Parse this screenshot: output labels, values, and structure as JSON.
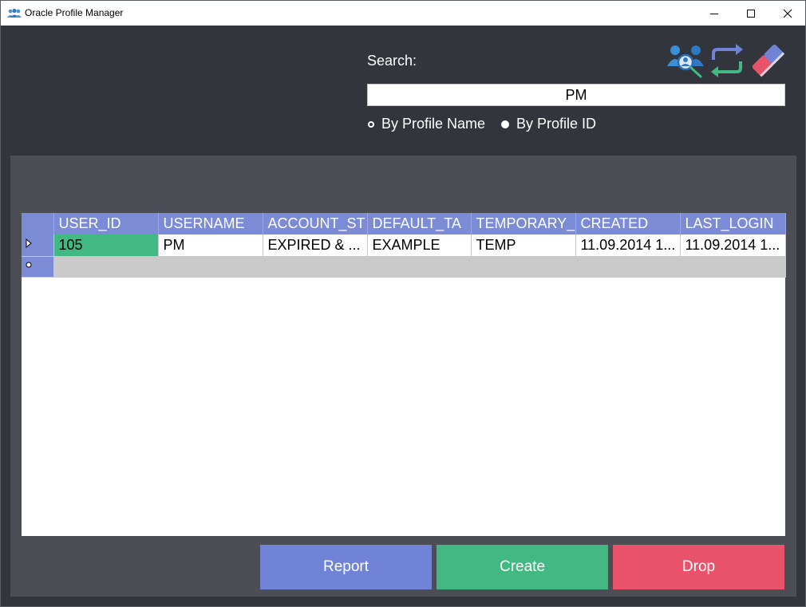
{
  "window": {
    "title": "Oracle Profile Manager"
  },
  "search": {
    "label": "Search:",
    "value": "PM",
    "modes": [
      {
        "label": "By Profile Name",
        "selected": false
      },
      {
        "label": "By Profile ID",
        "selected": true
      }
    ]
  },
  "toolbar": {
    "icons": [
      "search-users-icon",
      "refresh-icon",
      "eraser-icon"
    ]
  },
  "grid": {
    "columns": [
      "USER_ID",
      "USERNAME",
      "ACCOUNT_ST",
      "DEFAULT_TA",
      "TEMPORARY_",
      "CREATED",
      "LAST_LOGIN"
    ],
    "rows": [
      [
        "105",
        "PM",
        "EXPIRED & ...",
        "EXAMPLE",
        "TEMP",
        "11.09.2014 1...",
        "11.09.2014 1..."
      ]
    ]
  },
  "actions": {
    "report_label": "Report",
    "create_label": "Create",
    "drop_label": "Drop"
  },
  "colors": {
    "background": "#32353c",
    "panel": "#4b4e55",
    "header": "#7b8bd6",
    "report": "#7183d6",
    "create": "#42b883",
    "drop": "#e8526a"
  }
}
